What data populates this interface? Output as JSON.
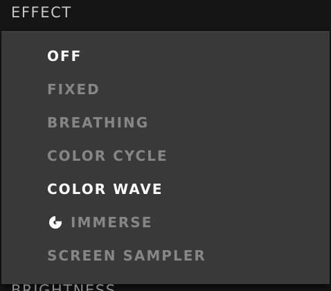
{
  "header": {
    "title": "EFFECT",
    "next_section_title": "BRIGHTNESS"
  },
  "menu": {
    "items": [
      {
        "label": "OFF",
        "state": "active"
      },
      {
        "label": "FIXED",
        "state": "inactive"
      },
      {
        "label": "BREATHING",
        "state": "inactive"
      },
      {
        "label": "COLOR CYCLE",
        "state": "inactive"
      },
      {
        "label": "COLOR WAVE",
        "state": "active"
      },
      {
        "label": "IMMERSE",
        "state": "inactive",
        "icon": "logitech-g-icon"
      },
      {
        "label": "SCREEN SAMPLER",
        "state": "inactive"
      }
    ]
  },
  "colors": {
    "background": "#151515",
    "dropdown": "#393939",
    "active_text": "#ffffff",
    "inactive_text": "#868686"
  }
}
